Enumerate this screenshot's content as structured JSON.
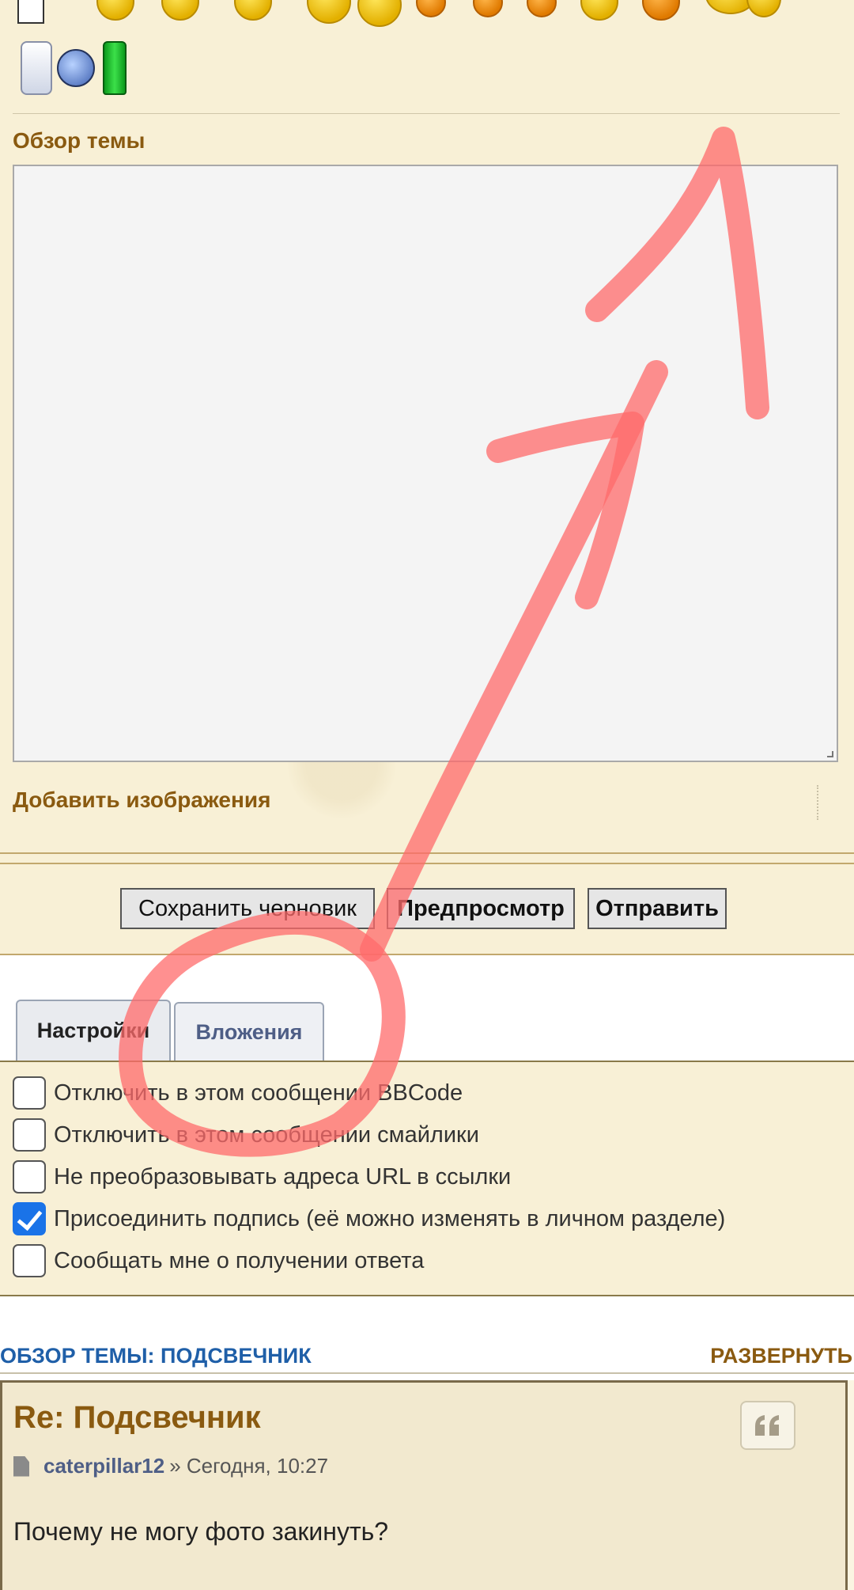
{
  "editor": {
    "topic_review_label": "Обзор темы",
    "add_images_label": "Добавить изображения"
  },
  "buttons": {
    "save_draft": "Сохранить черновик",
    "preview": "Предпросмотр",
    "submit": "Отправить"
  },
  "tabs": [
    {
      "label": "Настройки",
      "active": true
    },
    {
      "label": "Вложения",
      "active": false
    }
  ],
  "options": [
    {
      "label": "Отключить в этом сообщении BBCode",
      "checked": false
    },
    {
      "label": "Отключить в этом сообщении смайлики",
      "checked": false
    },
    {
      "label": "Не преобразовывать адреса URL в ссылки",
      "checked": false
    },
    {
      "label": "Присоединить подпись (её можно изменять в личном разделе)",
      "checked": true
    },
    {
      "label": "Сообщать мне о получении ответа",
      "checked": false
    }
  ],
  "review": {
    "title": "ОБЗОР ТЕМЫ: ПОДСВЕЧНИК",
    "expand": "РАЗВЕРНУТЬ"
  },
  "post": {
    "title": "Re: Подсвечник",
    "author": "caterpillar12",
    "date": "» Сегодня, 10:27",
    "body": "Почему не могу фото закинуть?"
  },
  "colors": {
    "annotation": "#ff6b6b",
    "link_blue": "#1f5fa8",
    "brown": "#8a5a10"
  }
}
